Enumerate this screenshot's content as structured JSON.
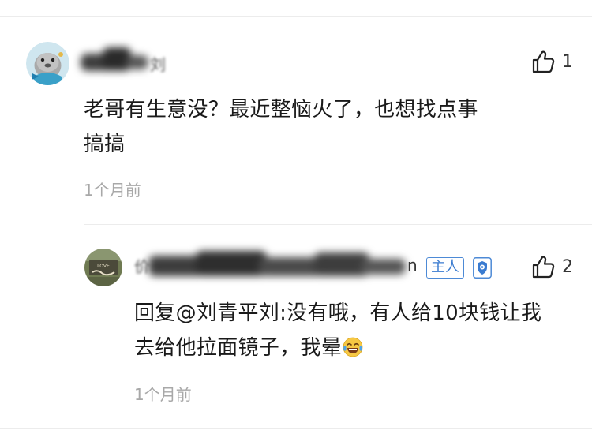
{
  "comment": {
    "author_visible_suffix": "刘",
    "text_line1": "老哥有生意没？最近整恼火了，也想找点事",
    "text_line2": "搞搞",
    "time": "1个月前",
    "like_count": "1",
    "avatar_icon": "seal-avatar-icon"
  },
  "reply": {
    "author_visible_prefix": "价",
    "author_visible_suffix": "n",
    "host_badge": "主人",
    "verified_icon": "shield-badge-icon",
    "text_line1": "回复@刘青平刘:没有哦，有人给10块钱让我",
    "text_line2": "去给他拉面镜子，我晕",
    "emoji": "tears-of-joy-emoji",
    "time": "1个月前",
    "like_count": "2",
    "avatar_icon": "love-sign-photo-avatar"
  },
  "colors": {
    "badge_blue": "#3a7bd0",
    "time_gray": "#a8a8a8",
    "divider": "#ececec"
  }
}
